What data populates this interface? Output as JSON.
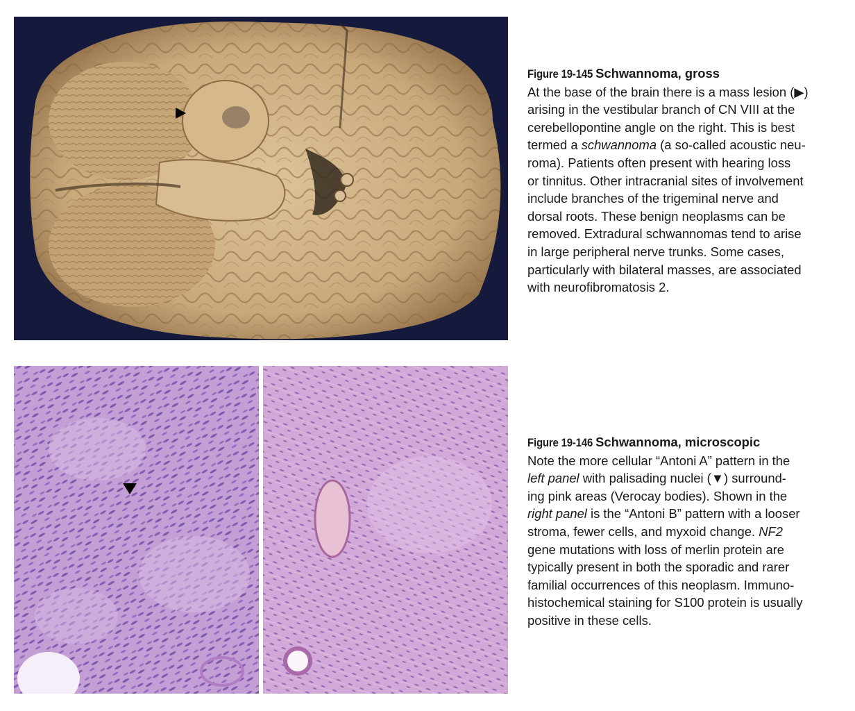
{
  "figure_145": {
    "number": "Figure 19-145",
    "title": "Schwannoma, gross",
    "lines": [
      "At the base of the brain there is a mass lesion (▶)",
      "arising in the vestibular branch of CN VIII at the",
      "cerebellopontine angle on the right. This is best",
      [
        "termed a ",
        "schwannoma",
        " (a so-called acoustic neu-"
      ],
      "roma). Patients often present with hearing loss",
      "or tinnitus. Other intracranial sites of involvement",
      "include branches of the trigeminal nerve and",
      "dorsal roots. These benign neoplasms can be",
      "removed. Extradural schwannomas tend to arise",
      "in large peripheral nerve trunks. Some cases,",
      "particularly with bilateral masses, are associated",
      "with neurofibromatosis 2."
    ]
  },
  "figure_146": {
    "number": "Figure 19-146",
    "title": "Schwannoma, microscopic",
    "lines": [
      "Note the more cellular “Antoni A” pattern in the",
      [
        "",
        "left  panel",
        " with palisading nuclei (▼) surround-"
      ],
      "ing pink areas (Verocay bodies). Shown in the",
      [
        "",
        "right  panel",
        " is the “Antoni B” pattern with a looser"
      ],
      [
        "stroma, fewer cells, and myxoid change. ",
        "NF2",
        ""
      ],
      "gene mutations with loss of merlin protein are",
      "typically present in both the sporadic and rarer",
      "familial occurrences of this neoplasm. Immuno-",
      "histochemical staining for S100 protein is usually",
      "positive in these cells."
    ]
  },
  "colors": {
    "gross_background": "#151a3d",
    "brain_tissue": "#c9a97a",
    "brain_shadow": "#7d5e3b",
    "he_stain_pink": "#c9a0d6",
    "he_stain_nuclei": "#6b3fa0"
  },
  "icons": {
    "gross_pointer": "triangle-right-icon",
    "micro_pointer": "triangle-down-icon"
  }
}
